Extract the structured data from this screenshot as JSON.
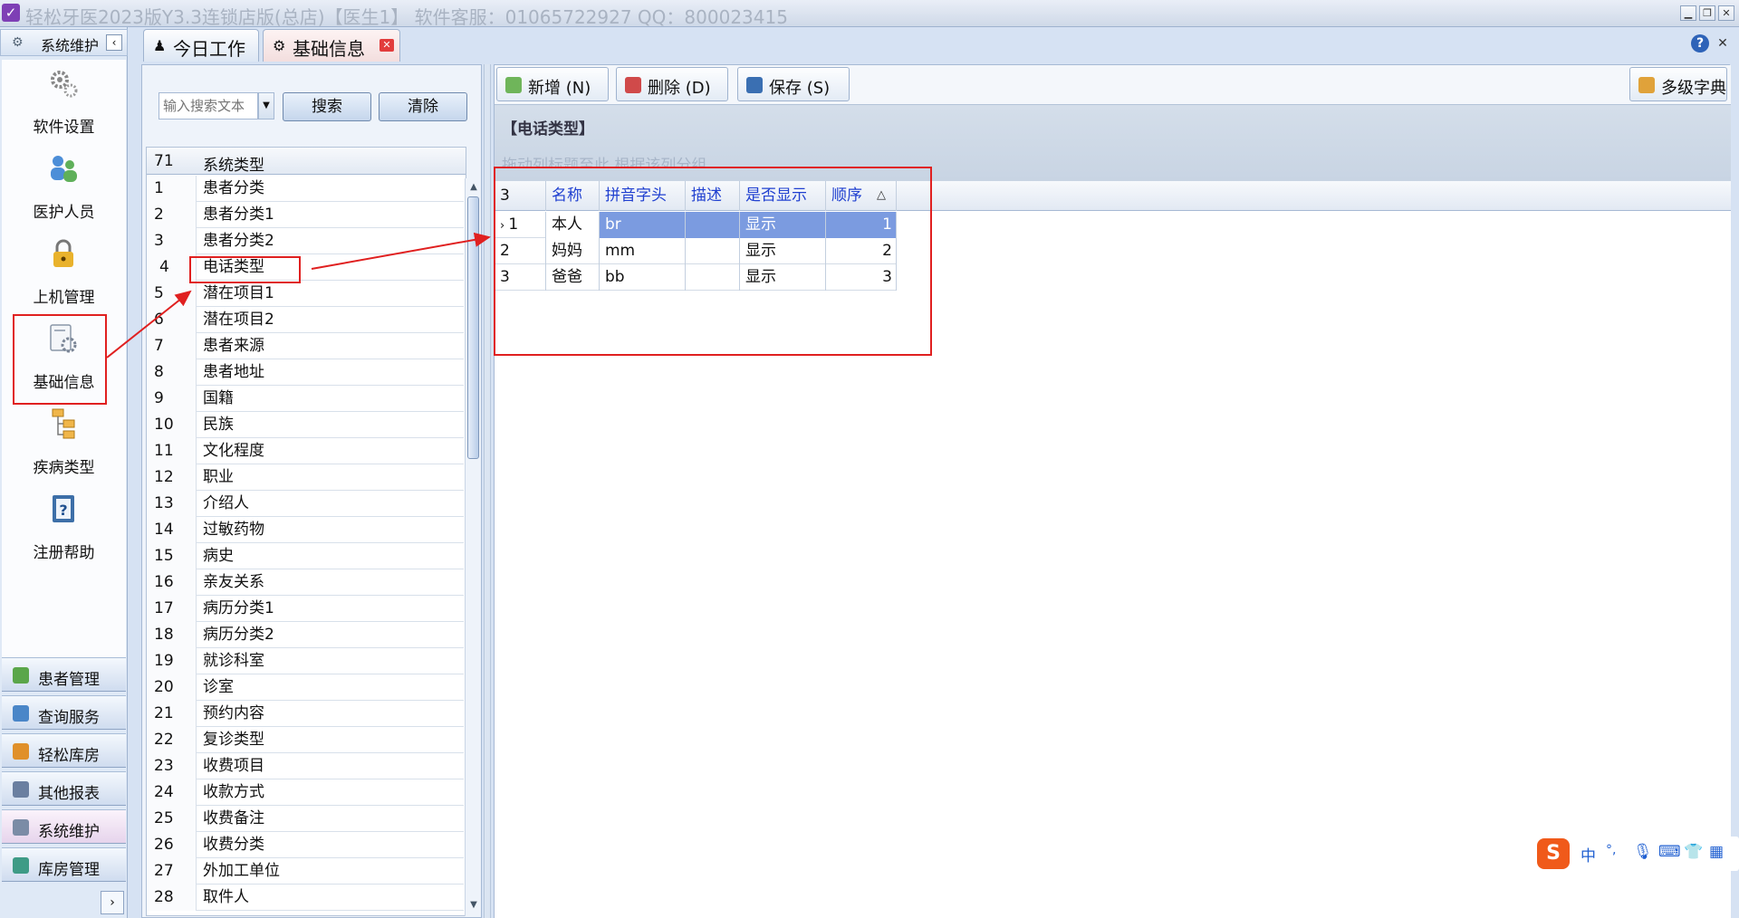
{
  "window": {
    "title": "轻松牙医2023版Y3.3连锁店版(总店)【医生1】    软件客服：01065722927 QQ：800023415",
    "controls": [
      "minimize",
      "restore",
      "close"
    ]
  },
  "sidebar": {
    "header": "系统维护",
    "items": [
      {
        "label": "软件设置",
        "icon": "gears-icon"
      },
      {
        "label": "医护人员",
        "icon": "staff-icon"
      },
      {
        "label": "上机管理",
        "icon": "lock-icon"
      },
      {
        "label": "基础信息",
        "icon": "settings-doc-icon"
      },
      {
        "label": "疾病类型",
        "icon": "tree-icon"
      },
      {
        "label": "注册帮助",
        "icon": "help-book-icon"
      }
    ],
    "modules": [
      {
        "label": "患者管理",
        "color": "#5aa64a"
      },
      {
        "label": "查询服务",
        "color": "#4a86c8"
      },
      {
        "label": "轻松库房",
        "color": "#e0902a"
      },
      {
        "label": "其他报表",
        "color": "#6a7fa0"
      },
      {
        "label": "系统维护",
        "color": "#7b8ca6"
      },
      {
        "label": "库房管理",
        "color": "#3e9b86"
      }
    ],
    "active_module": "系统维护"
  },
  "tabs": [
    {
      "label": "今日工作",
      "icon": "work-icon",
      "active": false
    },
    {
      "label": "基础信息",
      "icon": "settings-doc-icon",
      "active": true,
      "closable": true
    }
  ],
  "search": {
    "placeholder": "输入搜索文本",
    "search_label": "搜索",
    "clear_label": "清除"
  },
  "type_list": {
    "count": "71",
    "header": "系统类型",
    "selected": "4",
    "rows": [
      {
        "no": "1",
        "name": "患者分类"
      },
      {
        "no": "2",
        "name": "患者分类1"
      },
      {
        "no": "3",
        "name": "患者分类2"
      },
      {
        "no": "4",
        "name": "电话类型"
      },
      {
        "no": "5",
        "name": "潜在项目1"
      },
      {
        "no": "6",
        "name": "潜在项目2"
      },
      {
        "no": "7",
        "name": "患者来源"
      },
      {
        "no": "8",
        "name": "患者地址"
      },
      {
        "no": "9",
        "name": "国籍"
      },
      {
        "no": "10",
        "name": "民族"
      },
      {
        "no": "11",
        "name": "文化程度"
      },
      {
        "no": "12",
        "name": "职业"
      },
      {
        "no": "13",
        "name": "介绍人"
      },
      {
        "no": "14",
        "name": "过敏药物"
      },
      {
        "no": "15",
        "name": "病史"
      },
      {
        "no": "16",
        "name": "亲友关系"
      },
      {
        "no": "17",
        "name": "病历分类1"
      },
      {
        "no": "18",
        "name": "病历分类2"
      },
      {
        "no": "19",
        "name": "就诊科室"
      },
      {
        "no": "20",
        "name": "诊室"
      },
      {
        "no": "21",
        "name": "预约内容"
      },
      {
        "no": "22",
        "name": "复诊类型"
      },
      {
        "no": "23",
        "name": "收费项目"
      },
      {
        "no": "24",
        "name": "收款方式"
      },
      {
        "no": "25",
        "name": "收费备注"
      },
      {
        "no": "26",
        "name": "收费分类"
      },
      {
        "no": "27",
        "name": "外加工单位"
      },
      {
        "no": "28",
        "name": "取件人"
      }
    ]
  },
  "toolbar": {
    "new_label": "新增 (N)",
    "delete_label": "删除 (D)",
    "save_label": "保存 (S)",
    "multi_dict_label": "多级字典"
  },
  "detail": {
    "group_title": "【电话类型】",
    "group_hint": "拖动列标题至此,根据该列分组",
    "count": "3",
    "columns": [
      "名称",
      "拼音字头",
      "描述",
      "是否显示",
      "顺序"
    ],
    "sort_indicator": "△",
    "rows": [
      {
        "no": "1",
        "name": "本人",
        "pinyin": "br",
        "desc": "",
        "show": "显示",
        "order": "1"
      },
      {
        "no": "2",
        "name": "妈妈",
        "pinyin": "mm",
        "desc": "",
        "show": "显示",
        "order": "2"
      },
      {
        "no": "3",
        "name": "爸爸",
        "pinyin": "bb",
        "desc": "",
        "show": "显示",
        "order": "3"
      }
    ]
  },
  "ime": {
    "logo": "S",
    "mode": "中",
    "punct": "°,",
    "items": [
      "mic-icon",
      "keyboard-icon",
      "skin-icon",
      "grid-icon"
    ]
  },
  "colors": {
    "annotation": "#e02020",
    "selection": "#7b9be0",
    "header_text": "#2040d0"
  }
}
